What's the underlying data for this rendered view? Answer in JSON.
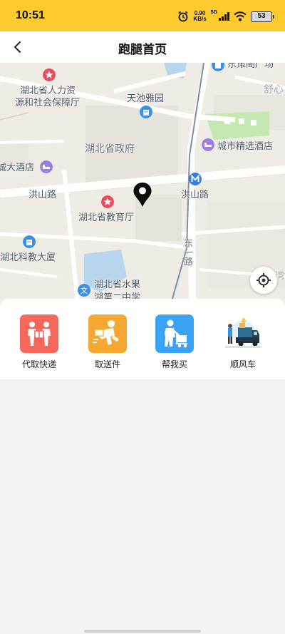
{
  "status_bar": {
    "time": "10:51",
    "net_speed_value": "0.90",
    "net_speed_unit": "KB/s",
    "network": "5G",
    "battery": "53",
    "icons": [
      "alarm-icon",
      "signal-icon",
      "wifi-icon",
      "battery-icon"
    ]
  },
  "header": {
    "title": "跑腿首页",
    "back_icon": "chevron-left-icon"
  },
  "map": {
    "labels": {
      "hr_dept_line1": "湖北省人力资",
      "hr_dept_line2": "源和社会保障厅",
      "tianchi": "天池雅园",
      "gov": "湖北省政府",
      "city_hotel": "城市精选酒店",
      "hotel_left": "城大酒店",
      "hongshan_road_left": "洪山路",
      "hongshan_road_station": "洪山路",
      "edu_dept": "湖北省教育厅",
      "keji": "湖北科教大厦",
      "east_road": "东一路",
      "school_line1": "湖北省水果",
      "school_line2": "湖第二中学",
      "shuyuan": "舒心",
      "top_partial": "东策阁广场",
      "right_partial": "湾"
    },
    "colors": {
      "base": "#efece5",
      "road": "#ffffff",
      "block": "#e6e3dc",
      "green": "#c5e8b0",
      "water": "#b9d6ef",
      "rail": "#7d8ea6"
    },
    "locate_icon": "crosshair-icon",
    "pin_icon": "location-pin-icon"
  },
  "services": [
    {
      "label": "代取快递",
      "color": "#f4675a",
      "icon": "package-handover-icon"
    },
    {
      "label": "取送件",
      "color": "#f6a731",
      "icon": "courier-running-icon"
    },
    {
      "label": "帮我买",
      "color": "#3aa3f6",
      "icon": "shopping-cart-icon"
    },
    {
      "label": "顺风车",
      "color": "#ffffff",
      "icon": "moving-truck-icon"
    }
  ]
}
